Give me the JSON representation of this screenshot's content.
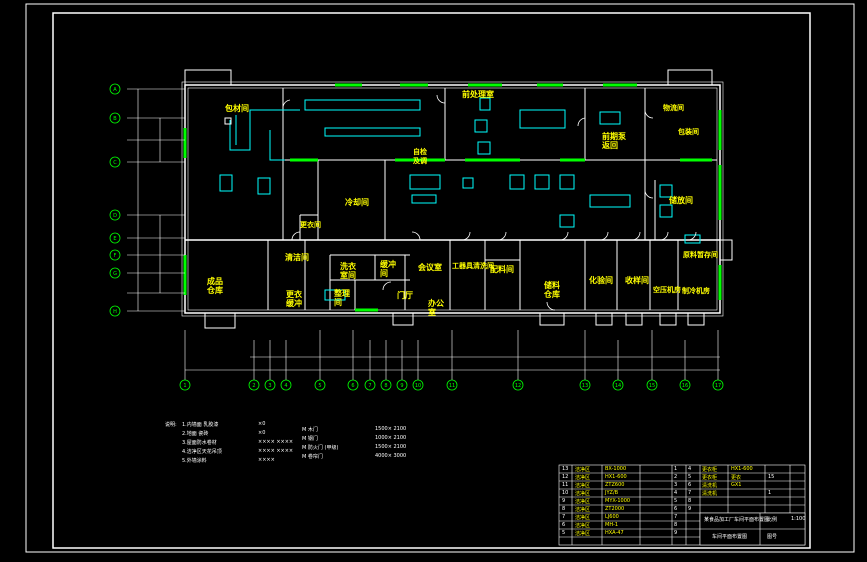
{
  "drawing": {
    "rooms": [
      {
        "id": "r1",
        "label": "包材间"
      },
      {
        "id": "r2",
        "label": "冷却间"
      },
      {
        "id": "r3",
        "label": "自检\n及调"
      },
      {
        "id": "r4",
        "label": "前处理室"
      },
      {
        "id": "r5",
        "label": "前期泵\n返回"
      },
      {
        "id": "r6",
        "label": "储放间"
      },
      {
        "id": "r7",
        "label": "更衣间"
      },
      {
        "id": "r8",
        "label": "成品\n仓库"
      },
      {
        "id": "r9",
        "label": "清洁间"
      },
      {
        "id": "r10",
        "label": "洗衣\n室间"
      },
      {
        "id": "r11",
        "label": "更衣\n缓冲"
      },
      {
        "id": "r12",
        "label": "缓冲\n间"
      },
      {
        "id": "r13",
        "label": "整理\n间"
      },
      {
        "id": "r14",
        "label": "会议室"
      },
      {
        "id": "r15",
        "label": "门厅"
      },
      {
        "id": "r16",
        "label": "办公\n室"
      },
      {
        "id": "r17",
        "label": "工器具清洗间"
      },
      {
        "id": "r18",
        "label": "配料间"
      },
      {
        "id": "r19",
        "label": "储料\n仓库"
      },
      {
        "id": "r20",
        "label": "化验间"
      },
      {
        "id": "r21",
        "label": "收样间"
      },
      {
        "id": "r22",
        "label": "空压机房"
      },
      {
        "id": "r23",
        "label": "制冷机房"
      },
      {
        "id": "r24",
        "label": "原料暂存间"
      },
      {
        "id": "r25",
        "label": "物流间"
      },
      {
        "id": "r26",
        "label": "包装间"
      }
    ],
    "vertical_axes": [
      "1",
      "2",
      "3",
      "4",
      "5",
      "6",
      "7",
      "8",
      "9",
      "10",
      "11",
      "12",
      "13",
      "14",
      "15",
      "16",
      "17"
    ],
    "horizontal_axes": [
      "A",
      "B",
      "C",
      "D",
      "E",
      "F",
      "G",
      "H"
    ],
    "legend": {
      "heading": "说明:",
      "rows_left": [
        "1.内墙面  乳胶漆",
        "2.地面  瓷砖",
        "3.屋面防水卷材",
        "4.洁净区天花吊顶",
        "5.外墙涂料"
      ],
      "rows_mid": [
        "×0",
        "×0",
        "×××× ××××",
        "×××× ××××",
        "××××"
      ],
      "rows_right": [
        "M  木门",
        "M  钢门",
        "M  防火门 (甲级)",
        "M  卷帘门"
      ],
      "rows_right_vals": [
        "1500× 2100",
        "1000× 2100",
        "1500× 2100",
        "4000× 3000"
      ]
    },
    "title_block": {
      "project": "某食品加工厂车间平面布置图",
      "drawing_name": "车间平面布置图",
      "rows": [
        [
          "13",
          "洁净区",
          "BX-1000",
          "",
          "1",
          "4",
          "更衣柜",
          "HX1-600",
          ""
        ],
        [
          "12",
          "洁净区",
          "HX1-600",
          "",
          "2",
          "5",
          "更衣柜",
          "更衣",
          "15"
        ],
        [
          "11",
          "洁净区",
          "ZTZ600",
          "",
          "3",
          "6",
          "清洗机",
          "GX1",
          ""
        ],
        [
          "10",
          "洁净区",
          "JYZ/B",
          "",
          "4",
          "7",
          "清洗机",
          "",
          "1"
        ],
        [
          "9",
          "洁净区",
          "MYX-1000",
          "",
          "5",
          "8",
          "",
          "",
          ""
        ],
        [
          "8",
          "洁净区",
          "ZT2000",
          "",
          "6",
          "9",
          "",
          "",
          ""
        ],
        [
          "7",
          "洁净区",
          "LJ600",
          "",
          "7",
          "",
          "",
          "",
          ""
        ],
        [
          "6",
          "洁净区",
          "MH-1",
          "",
          "8",
          "",
          "",
          "",
          ""
        ],
        [
          "5",
          "洁净区",
          "HXA-47",
          "",
          "9",
          "",
          "",
          "",
          ""
        ]
      ],
      "header": [
        "序号",
        "名称",
        "型号",
        "",
        "数量",
        "序号",
        "名称",
        "型号",
        "数量"
      ],
      "scale_label": "比例",
      "scale_value": "1:100",
      "sheet_label": "图号"
    }
  }
}
